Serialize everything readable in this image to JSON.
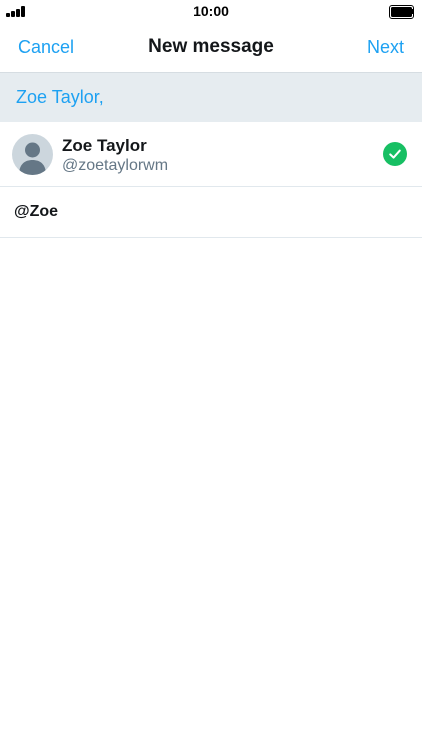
{
  "status_bar": {
    "time": "10:00",
    "signal_icon": "signal-bars-icon",
    "battery_icon": "battery-full-icon"
  },
  "nav": {
    "cancel_label": "Cancel",
    "title": "New message",
    "next_label": "Next"
  },
  "recipients": {
    "text": "Zoe Taylor,"
  },
  "results": [
    {
      "name": "Zoe Taylor",
      "handle": "@zoetaylorwm",
      "avatar_icon": "default-avatar-icon",
      "selected": true,
      "selected_icon": "check-circle-icon"
    }
  ],
  "query": {
    "text": "@Zoe"
  },
  "colors": {
    "accent": "#1da1f2",
    "selected_green": "#17bf63",
    "recipient_bar_bg": "#e6ecf0"
  }
}
